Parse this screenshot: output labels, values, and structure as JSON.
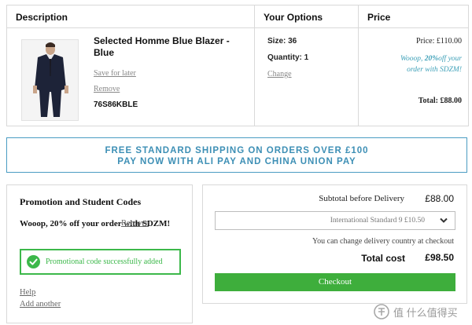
{
  "cart": {
    "headers": {
      "description": "Description",
      "options": "Your Options",
      "price": "Price"
    },
    "item": {
      "name": "Selected Homme Blue Blazer - Blue",
      "save_for_later": "Save for later",
      "remove": "Remove",
      "sku": "76S86KBLE",
      "size": "Size: 36",
      "quantity": "Quantity: 1",
      "change": "Change",
      "price": "Price: £110.00",
      "promo_prefix": "Wooop, ",
      "promo_percent": "20%",
      "promo_suffix": "off your order with SDZM!",
      "total": "Total:  £88.00"
    }
  },
  "shipping_banner": {
    "line1": "FREE STANDARD SHIPPING ON ORDERS OVER £100",
    "line2": "PAY NOW WITH ALI PAY AND CHINA UNION PAY",
    "color": "#3d8fb5"
  },
  "promotion": {
    "title": "Promotion and Student Codes",
    "applied_text": "Wooop, 20% off your order with SDZM!",
    "remove": "Remove",
    "success_message": "Promotional code successfully added",
    "help": "Help",
    "add_another": "Add another",
    "success_color": "#3cb84a"
  },
  "summary": {
    "subtotal_label": "Subtotal before Delivery",
    "subtotal_value": "£88.00",
    "delivery_option": "International Standard 9 £10.50",
    "country_note": "You can change delivery country at checkout",
    "total_label": "Total cost",
    "total_value": "£98.50",
    "checkout_label": "Checkout",
    "checkout_color": "#3eae3c"
  },
  "watermark": {
    "text": "值 什么值得买"
  },
  "icons": {
    "check": "check-circle-icon",
    "chevron": "chevron-down-icon",
    "logo": "smzdm-logo-icon"
  }
}
